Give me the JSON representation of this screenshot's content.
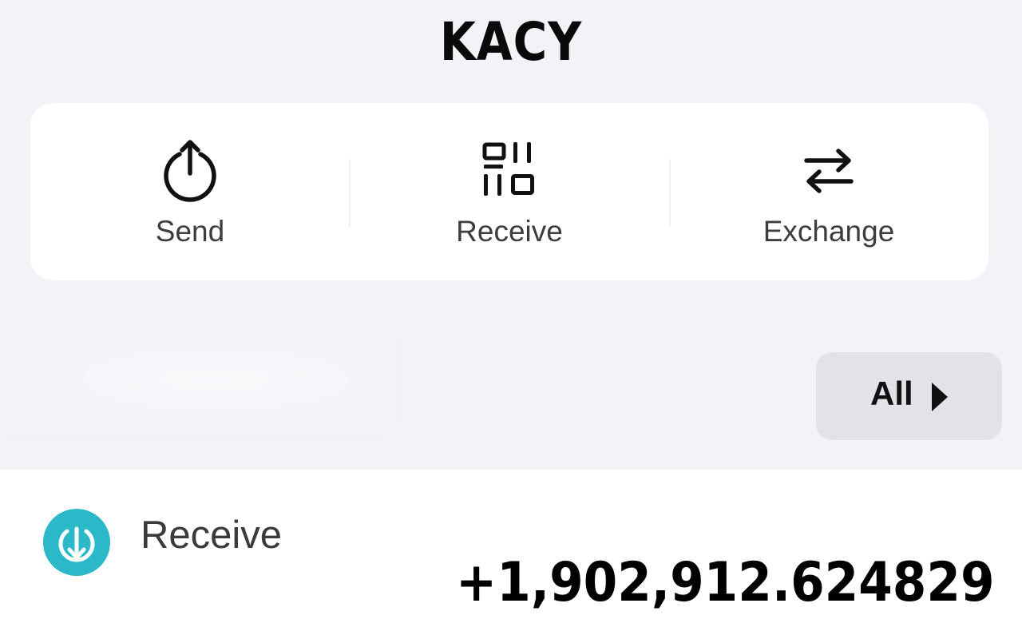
{
  "header": {
    "title": "KACY"
  },
  "actions": [
    {
      "label": "Send",
      "icon": "send-icon"
    },
    {
      "label": "Receive",
      "icon": "qr-code-icon"
    },
    {
      "label": "Exchange",
      "icon": "exchange-arrows-icon"
    }
  ],
  "filter": {
    "label": "All",
    "icon": "caret-right-icon"
  },
  "transaction": {
    "title": "Receive",
    "amount": "+1,902,912.624829",
    "icon": "receive-down-arrow-icon",
    "icon_color": "#2bb8c9"
  },
  "colors": {
    "background": "#f3f2f7",
    "card": "#ffffff",
    "filter_button": "#e2e2e7"
  }
}
